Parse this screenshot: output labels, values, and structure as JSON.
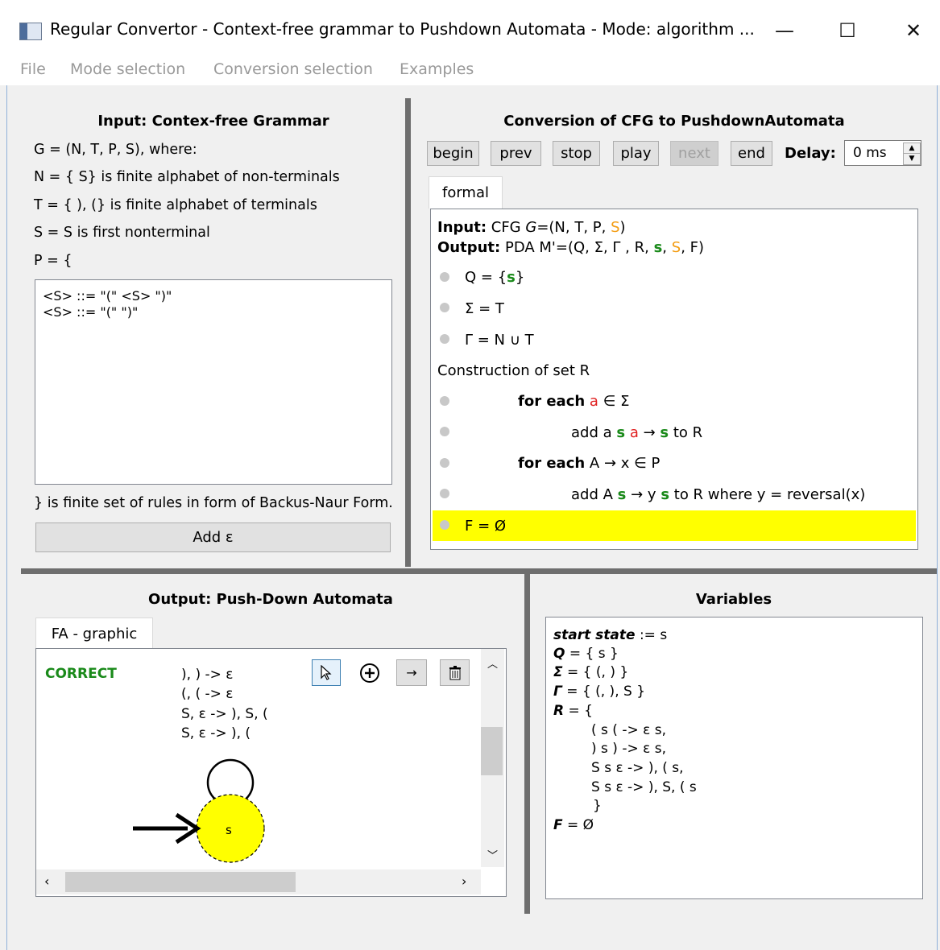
{
  "window": {
    "title": "Regular Convertor - Context-free grammar to Pushdown Automata - Mode: algorithm ...",
    "minimize_glyph": "—",
    "maximize_glyph": "☐",
    "close_glyph": "✕"
  },
  "menu": [
    "File",
    "Mode selection",
    "Conversion selection",
    "Examples"
  ],
  "input_panel": {
    "heading": "Input: Contex-free Grammar",
    "lines": [
      "G = (N, T, P, S), where:",
      "N = { S} is finite alphabet of non-terminals",
      "T = { ), (} is finite alphabet of terminals",
      "S = S is first nonterminal",
      "P = {"
    ],
    "rules": [
      "<S> ::= \"(\"  <S>  \")\"",
      "<S> ::= \"(\"  \")\""
    ],
    "footer": "} is finite set of rules in form of Backus-Naur Form.",
    "add_epsilon_button": "Add ε"
  },
  "conversion_panel": {
    "heading": "Conversion of CFG to PushdownAutomata",
    "buttons": {
      "begin": "begin",
      "prev": "prev",
      "stop": "stop",
      "play": "play",
      "next": "next",
      "end": "end"
    },
    "delay_label": "Delay:",
    "delay_value": "0 ms",
    "tab": "formal",
    "input_label": "Input:",
    "input_text_a": "CFG",
    "input_text_g": "G",
    "input_text_b": "=(N, T, P,",
    "input_text_s": "S",
    "input_text_c": ")",
    "output_label": "Output:",
    "output_text_a": "PDA M'=(Q, Σ, Γ , R,",
    "output_text_s1": "s",
    "output_text_sep": ",",
    "output_text_s2": "S",
    "output_text_c": ", F)",
    "line_q_a": "Q = {",
    "line_q_s": "s",
    "line_q_b": "}",
    "line_sigma": "Σ = T",
    "line_gamma": "Γ = N ∪ T",
    "construction": "Construction of set R",
    "for_each_1": "for each",
    "for_each_1_a": "a",
    "for_each_1_rest": "∈ Σ",
    "add_1_a": "add a",
    "add_1_s1": "s",
    "add_1_a2": "a",
    "add_1_arrow": "→",
    "add_1_s2": "s",
    "add_1_rest": "to R",
    "for_each_2": "for each",
    "for_each_2_rest": "A → x ∈ P",
    "add_2_a": "add A",
    "add_2_s1": "s",
    "add_2_mid": "→ y",
    "add_2_s2": "s",
    "add_2_rest": "to R where y = reversal(x)",
    "line_f": "F = Ø",
    "highlight_color": "#ffff00"
  },
  "output_panel": {
    "heading": "Output: Push-Down Automata",
    "tab": "FA - graphic",
    "status": "CORRECT",
    "status_color": "#1a8a1a",
    "transitions": [
      "), ) -> ε",
      "(, ( -> ε",
      "S, ε -> ), S, (",
      "S, ε -> ), ("
    ],
    "state_label": "s",
    "state_fill": "#ffff00",
    "tools": [
      "pointer-icon",
      "add-state-icon",
      "arrow-icon",
      "trash-icon"
    ]
  },
  "variables_panel": {
    "heading": "Variables",
    "start_label": "start state",
    "start_value": ":= s",
    "q_label": "Q",
    "q_value": "= { s }",
    "sigma_label": "Σ",
    "sigma_value": "= { (, ) }",
    "gamma_label": "Γ",
    "gamma_value": "= { (, ), S }",
    "r_label": "R",
    "r_value": "= {",
    "r_items": [
      "( s ( -> ε s,",
      ") s ) -> ε s,",
      "S s ε -> ), ( s,",
      "S s ε -> ), S, ( s",
      "}"
    ],
    "f_label": "F",
    "f_value": "= Ø"
  }
}
